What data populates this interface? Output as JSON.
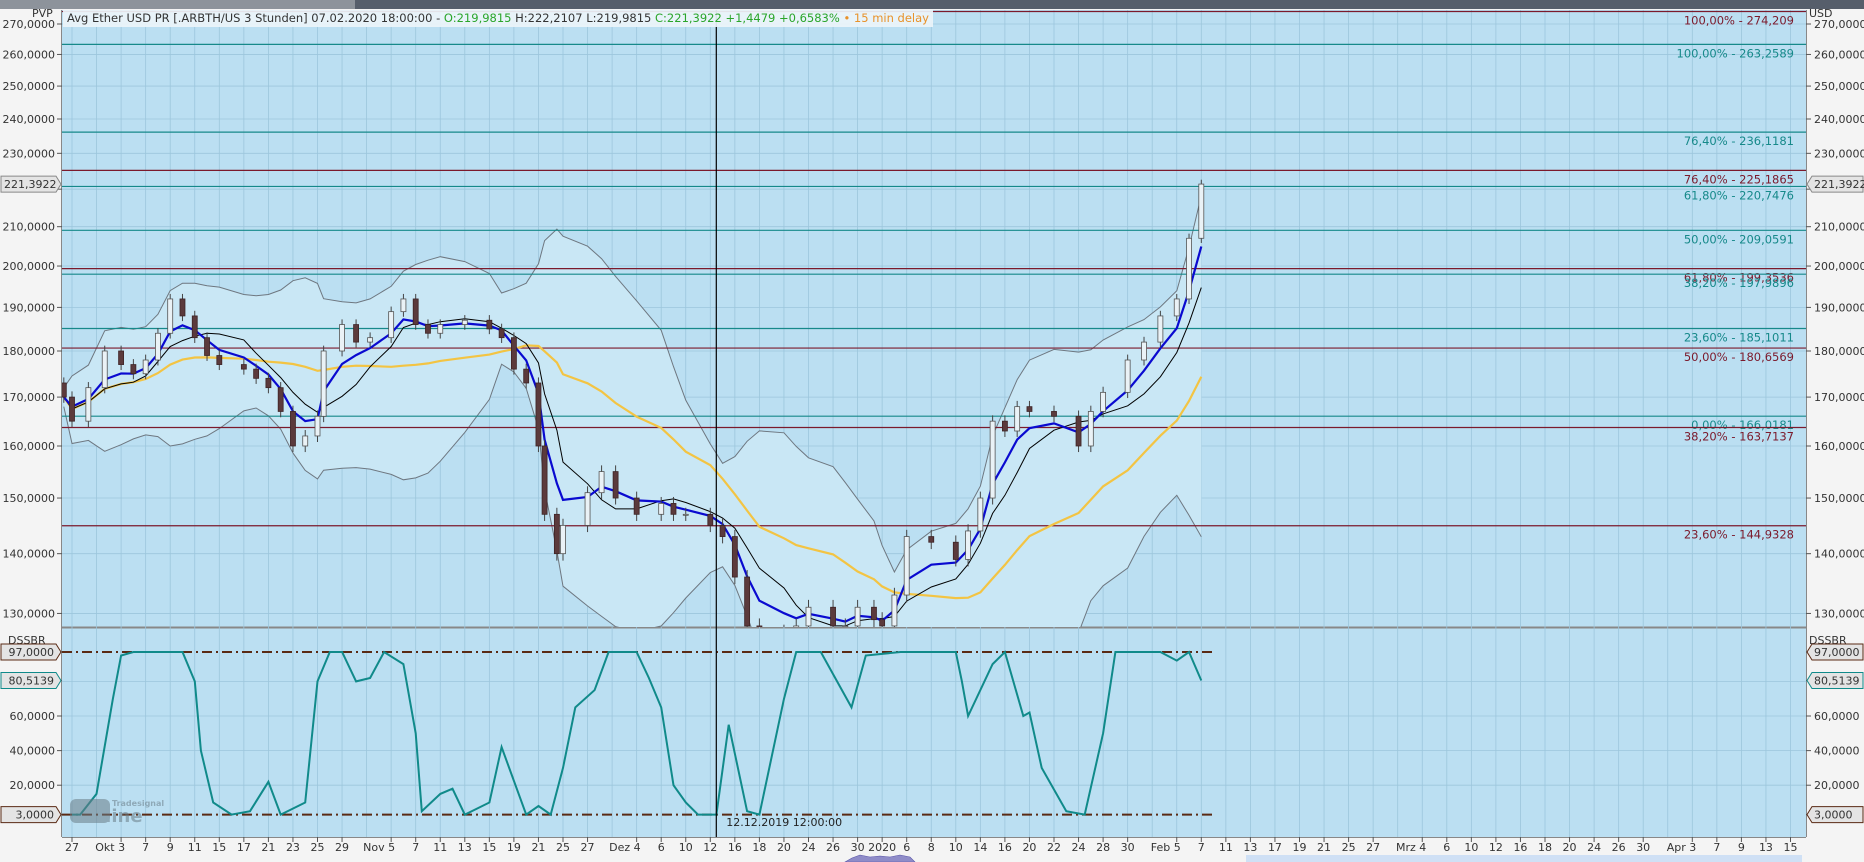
{
  "header": {
    "instrument": "Avg Ether USD PR [.ARBTH/US 3 Stunden]",
    "datetime": "07.02.2020 18:00:00",
    "separator": "-",
    "open": "O:219,9815",
    "high": "H:222,2107",
    "low": "L:219,9815",
    "close": "C:221,3922",
    "change": "+1,4479",
    "change_pct": "+0,6583%",
    "delay_dot": "•",
    "delay": "15 min delay"
  },
  "colors": {
    "background": "#bbdff2",
    "band_fill": "#c9e7f5",
    "grid": "#9cc6dc",
    "fib_teal": "#16898a",
    "fib_red": "#7b1a2c",
    "ma_fast": "#0a0ad0",
    "ma_mid": "#000000",
    "ma_slow": "#f3c443",
    "bands": "#6e7780",
    "candle_up": "#eaf2f6",
    "candle_down": "#5b3a3c",
    "oscillator": "#108a8a",
    "threshold": "#5a2a14"
  },
  "x_axis": {
    "tick_labels": [
      "27",
      "Okt 3",
      "7",
      "9",
      "11",
      "15",
      "17",
      "21",
      "23",
      "25",
      "29",
      "Nov 5",
      "7",
      "11",
      "13",
      "15",
      "19",
      "21",
      "25",
      "27",
      "Dez 4",
      "6",
      "10",
      "12",
      "16",
      "18",
      "20",
      "24",
      "26",
      "30",
      "2020",
      "6",
      "8",
      "10",
      "14",
      "16",
      "20",
      "22",
      "24",
      "28",
      "30",
      "Feb 5",
      "7",
      "11",
      "13",
      "17",
      "19",
      "21",
      "25",
      "27",
      "Mrz 4",
      "6",
      "10",
      "12",
      "16",
      "18",
      "20",
      "24",
      "26",
      "30",
      "Apr 3",
      "7",
      "9",
      "13",
      "15"
    ]
  },
  "crosshair": {
    "label": "12.12.2019 12:00:00"
  },
  "logo": {
    "brand": "Tradesignal",
    "text": "online"
  },
  "chart_data": [
    {
      "type": "candlestick",
      "left_label": "PVP",
      "ylabel": "USD",
      "scale": "log",
      "ylim": [
        128,
        275
      ],
      "grid": true,
      "yticks": [
        270,
        260,
        250,
        240,
        230,
        220,
        210,
        200,
        190,
        180,
        170,
        160,
        150,
        140,
        130
      ],
      "ytick_labels": [
        "270,0000",
        "260,0000",
        "250,0000",
        "240,0000",
        "230,0000",
        "",
        "210,0000",
        "200,0000",
        "190,0000",
        "180,0000",
        "170,0000",
        "160,0000",
        "150,0000",
        "140,0000",
        "130,0000"
      ],
      "last_value": 221.3922,
      "last_value_label": "221,3922",
      "fib_levels": [
        {
          "value": 274.209,
          "label": "100,00% - 274,209",
          "color": "red"
        },
        {
          "value": 263.2589,
          "label": "100,00% - 263,2589",
          "color": "teal"
        },
        {
          "value": 236.1181,
          "label": "76,40% - 236,1181",
          "color": "teal"
        },
        {
          "value": 225.1865,
          "label": "76,40% - 225,1865",
          "color": "red"
        },
        {
          "value": 220.7476,
          "label": "61,80% - 220,7476",
          "color": "teal"
        },
        {
          "value": 209.0591,
          "label": "50,00% - 209,0591",
          "color": "teal"
        },
        {
          "value": 199.3536,
          "label": "61,80% - 199,3536",
          "color": "red"
        },
        {
          "value": 197.9896,
          "label": "38,20% - 197,9896",
          "color": "teal"
        },
        {
          "value": 185.1011,
          "label": "23,60% - 185,1011",
          "color": "teal"
        },
        {
          "value": 180.6569,
          "label": "50,00% - 180,6569",
          "color": "red"
        },
        {
          "value": 166.0181,
          "label": "0,00% - 166,0181",
          "color": "teal"
        },
        {
          "value": 163.7137,
          "label": "38,20% - 163,7137",
          "color": "red"
        },
        {
          "value": 144.9328,
          "label": "23,60% - 144,9328",
          "color": "red"
        }
      ],
      "close": [
        [
          "2019-09-26",
          170
        ],
        [
          "2019-09-27",
          165
        ],
        [
          "2019-09-29",
          172
        ],
        [
          "2019-10-01",
          180
        ],
        [
          "2019-10-03",
          177
        ],
        [
          "2019-10-05",
          175
        ],
        [
          "2019-10-07",
          178
        ],
        [
          "2019-10-08",
          184
        ],
        [
          "2019-10-09",
          192
        ],
        [
          "2019-10-10",
          188
        ],
        [
          "2019-10-11",
          183
        ],
        [
          "2019-10-13",
          179
        ],
        [
          "2019-10-15",
          177
        ],
        [
          "2019-10-17",
          176
        ],
        [
          "2019-10-19",
          174
        ],
        [
          "2019-10-21",
          172
        ],
        [
          "2019-10-22",
          167
        ],
        [
          "2019-10-23",
          160
        ],
        [
          "2019-10-24",
          162
        ],
        [
          "2019-10-25",
          166
        ],
        [
          "2019-10-26",
          180
        ],
        [
          "2019-10-29",
          186
        ],
        [
          "2019-10-31",
          182
        ],
        [
          "2019-11-02",
          183
        ],
        [
          "2019-11-05",
          189
        ],
        [
          "2019-11-06",
          192
        ],
        [
          "2019-11-07",
          186
        ],
        [
          "2019-11-09",
          184
        ],
        [
          "2019-11-11",
          186
        ],
        [
          "2019-11-13",
          187
        ],
        [
          "2019-11-15",
          185
        ],
        [
          "2019-11-17",
          183
        ],
        [
          "2019-11-19",
          176
        ],
        [
          "2019-11-20",
          173
        ],
        [
          "2019-11-21",
          160
        ],
        [
          "2019-11-22",
          147
        ],
        [
          "2019-11-24",
          140
        ],
        [
          "2019-11-25",
          145
        ],
        [
          "2019-11-27",
          151
        ],
        [
          "2019-11-29",
          155
        ],
        [
          "2019-12-01",
          150
        ],
        [
          "2019-12-04",
          147
        ],
        [
          "2019-12-06",
          149
        ],
        [
          "2019-12-08",
          147
        ],
        [
          "2019-12-10",
          147
        ],
        [
          "2019-12-12",
          145
        ],
        [
          "2019-12-14",
          143
        ],
        [
          "2019-12-16",
          136
        ],
        [
          "2019-12-17",
          128
        ],
        [
          "2019-12-18",
          126
        ],
        [
          "2019-12-20",
          127
        ],
        [
          "2019-12-22",
          128
        ],
        [
          "2019-12-24",
          131
        ],
        [
          "2019-12-26",
          128
        ],
        [
          "2019-12-28",
          128
        ],
        [
          "2019-12-30",
          131
        ],
        [
          "2020-01-01",
          129
        ],
        [
          "2020-01-02",
          128
        ],
        [
          "2020-01-04",
          133
        ],
        [
          "2020-01-06",
          143
        ],
        [
          "2020-01-08",
          142
        ],
        [
          "2020-01-10",
          139
        ],
        [
          "2020-01-12",
          144
        ],
        [
          "2020-01-14",
          150
        ],
        [
          "2020-01-15",
          165
        ],
        [
          "2020-01-16",
          163
        ],
        [
          "2020-01-18",
          168
        ],
        [
          "2020-01-20",
          167
        ],
        [
          "2020-01-22",
          166
        ],
        [
          "2020-01-24",
          160
        ],
        [
          "2020-01-26",
          167
        ],
        [
          "2020-01-28",
          171
        ],
        [
          "2020-01-30",
          178
        ],
        [
          "2020-02-01",
          182
        ],
        [
          "2020-02-03",
          188
        ],
        [
          "2020-02-05",
          192
        ],
        [
          "2020-02-06",
          207
        ],
        [
          "2020-02-07",
          221.3922
        ]
      ]
    },
    {
      "type": "line",
      "name": "DSSBR",
      "ylim": [
        -10,
        111
      ],
      "yticks": [
        97,
        80.5139,
        60,
        40,
        20,
        3
      ],
      "ytick_labels": [
        "97,0000",
        "80,5139",
        "60,0000",
        "40,0000",
        "20,0000",
        "3,0000"
      ],
      "thresholds": [
        97,
        3
      ],
      "last_value": 80.5139,
      "values": [
        [
          "2019-09-27",
          3
        ],
        [
          "2019-09-28",
          3
        ],
        [
          "2019-09-30",
          15
        ],
        [
          "2019-10-02",
          70
        ],
        [
          "2019-10-03",
          95
        ],
        [
          "2019-10-05",
          97
        ],
        [
          "2019-10-10",
          97
        ],
        [
          "2019-10-11",
          80
        ],
        [
          "2019-10-12",
          40
        ],
        [
          "2019-10-14",
          10
        ],
        [
          "2019-10-16",
          3
        ],
        [
          "2019-10-18",
          5
        ],
        [
          "2019-10-21",
          22
        ],
        [
          "2019-10-22",
          3
        ],
        [
          "2019-10-24",
          10
        ],
        [
          "2019-10-25",
          80
        ],
        [
          "2019-10-27",
          97
        ],
        [
          "2019-10-29",
          97
        ],
        [
          "2019-10-31",
          80
        ],
        [
          "2019-11-02",
          82
        ],
        [
          "2019-11-04",
          97
        ],
        [
          "2019-11-06",
          90
        ],
        [
          "2019-11-07",
          50
        ],
        [
          "2019-11-08",
          5
        ],
        [
          "2019-11-11",
          15
        ],
        [
          "2019-11-12",
          18
        ],
        [
          "2019-11-13",
          3
        ],
        [
          "2019-11-15",
          10
        ],
        [
          "2019-11-17",
          42
        ],
        [
          "2019-11-20",
          3
        ],
        [
          "2019-11-21",
          8
        ],
        [
          "2019-11-23",
          3
        ],
        [
          "2019-11-25",
          30
        ],
        [
          "2019-11-26",
          65
        ],
        [
          "2019-11-28",
          75
        ],
        [
          "2019-11-30",
          97
        ],
        [
          "2019-12-04",
          97
        ],
        [
          "2019-12-05",
          82
        ],
        [
          "2019-12-06",
          65
        ],
        [
          "2019-12-08",
          20
        ],
        [
          "2019-12-10",
          10
        ],
        [
          "2019-12-11",
          3
        ],
        [
          "2019-12-13",
          3
        ],
        [
          "2019-12-15",
          55
        ],
        [
          "2019-12-17",
          5
        ],
        [
          "2019-12-18",
          3
        ],
        [
          "2019-12-20",
          70
        ],
        [
          "2019-12-22",
          97
        ],
        [
          "2019-12-25",
          97
        ],
        [
          "2019-12-29",
          65
        ],
        [
          "2019-12-31",
          95
        ],
        [
          "2020-01-05",
          97
        ],
        [
          "2020-01-10",
          97
        ],
        [
          "2020-01-11",
          80
        ],
        [
          "2020-01-12",
          60
        ],
        [
          "2020-01-15",
          90
        ],
        [
          "2020-01-16",
          97
        ],
        [
          "2020-01-19",
          60
        ],
        [
          "2020-01-20",
          62
        ],
        [
          "2020-01-21",
          30
        ],
        [
          "2020-01-23",
          5
        ],
        [
          "2020-01-25",
          3
        ],
        [
          "2020-01-28",
          50
        ],
        [
          "2020-01-29",
          97
        ],
        [
          "2020-02-03",
          97
        ],
        [
          "2020-02-05",
          92
        ],
        [
          "2020-02-06",
          97
        ],
        [
          "2020-02-07",
          80.5139
        ]
      ]
    }
  ]
}
